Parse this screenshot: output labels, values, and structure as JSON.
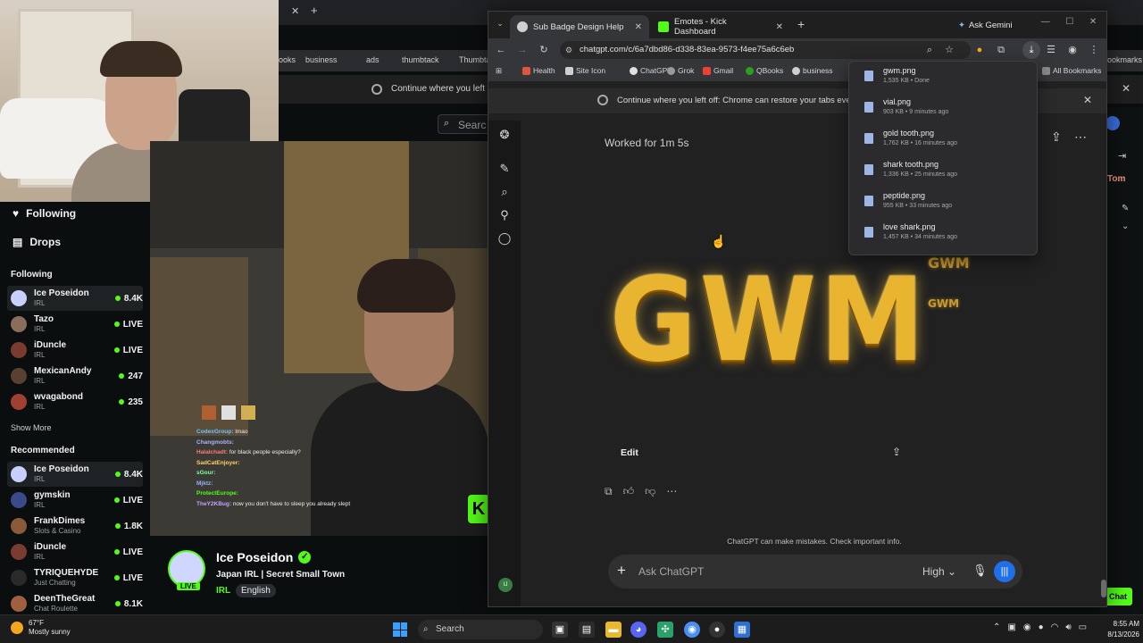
{
  "kick": {
    "browser_bookmarks": [
      "ooks",
      "business",
      "ads",
      "thumbtack",
      "Thumbta"
    ],
    "bookmarks_right": "ookmarks",
    "restore_text": "Continue where you left off:",
    "search_placeholder": "Searc",
    "nav": {
      "following": "Following",
      "drops": "Drops"
    },
    "following_label": "Following",
    "following": [
      {
        "name": "Ice Poseidon",
        "category": "IRL",
        "viewers": "8.4K",
        "color": "#c7d0ff"
      },
      {
        "name": "Tazo",
        "category": "IRL",
        "viewers": "LIVE",
        "color": "#8a6d5a"
      },
      {
        "name": "iDuncle",
        "category": "IRL",
        "viewers": "LIVE",
        "color": "#7a3b30"
      },
      {
        "name": "MexicanAndy",
        "category": "IRL",
        "viewers": "247",
        "color": "#5a4030"
      },
      {
        "name": "wvagabond",
        "category": "IRL",
        "viewers": "235",
        "color": "#a04030"
      }
    ],
    "show_more": "Show More",
    "recommended_label": "Recommended",
    "recommended": [
      {
        "name": "Ice Poseidon",
        "category": "IRL",
        "viewers": "8.4K",
        "color": "#c7d0ff"
      },
      {
        "name": "gymskin",
        "category": "IRL",
        "viewers": "LIVE",
        "color": "#3a4a8a"
      },
      {
        "name": "FrankDimes",
        "category": "Slots & Casino",
        "viewers": "1.8K",
        "color": "#8a5a3a"
      },
      {
        "name": "iDuncle",
        "category": "IRL",
        "viewers": "LIVE",
        "color": "#7a3b30"
      },
      {
        "name": "TYRIQUEHYDE",
        "category": "Just Chatting",
        "viewers": "LIVE",
        "color": "#2a2a2a"
      },
      {
        "name": "DeenTheGreat",
        "category": "Chat Roulette",
        "viewers": "8.1K",
        "color": "#a06040"
      }
    ],
    "chat": [
      {
        "user": "CodexGroup:",
        "msg": "lmao",
        "color": "#6ec3ff"
      },
      {
        "user": "Changmobts:",
        "msg": "",
        "color": "#b0b0ff"
      },
      {
        "user": "Halalchadt:",
        "msg": "for black people especially?",
        "color": "#ff7a7a"
      },
      {
        "user": "SadCatEnjoyer:",
        "msg": "",
        "color": "#ffd166"
      },
      {
        "user": "sGour:",
        "msg": "",
        "color": "#7fffa8"
      },
      {
        "user": "Mjktz:",
        "msg": "",
        "color": "#9ab0ff"
      },
      {
        "user": "ProtectEurope:",
        "msg": "",
        "color": "#53fc18"
      },
      {
        "user": "TheY2KBug:",
        "msg": "now you don't have to sleep you already slept",
        "color": "#c9a0ff"
      }
    ],
    "stream": {
      "live": "LIVE",
      "name": "Ice Poseidon",
      "title": "Japan IRL | Secret Small Town",
      "category": "IRL",
      "tag": "English"
    },
    "right_name": "Tom",
    "chat_button": "Chat"
  },
  "chrome": {
    "tabs": [
      {
        "label": "Sub Badge Design Help",
        "active": true
      },
      {
        "label": "Emotes - Kick Dashboard",
        "active": false
      }
    ],
    "ask_gemini": "Ask Gemini",
    "url": "chatgpt.com/c/6a7dbd86-d338-83ea-9573-f4ee75a6c6eb",
    "bookmarks": [
      "Health",
      "Site Icon",
      "ChatGPT",
      "Grok",
      "Gmail",
      "QBooks",
      "business"
    ],
    "all_bookmarks": "All Bookmarks",
    "restore_text": "Continue where you left off: Chrome can restore your tabs every tim",
    "downloads": [
      {
        "name": "gwm.png",
        "status": "1,535 KB • Done"
      },
      {
        "name": "vial.png",
        "status": "903 KB • 9 minutes ago"
      },
      {
        "name": "gold tooth.png",
        "status": "1,762 KB • 16 minutes ago"
      },
      {
        "name": "shark tooth.png",
        "status": "1,336 KB • 25 minutes ago"
      },
      {
        "name": "peptide.png",
        "status": "955 KB • 33 minutes ago"
      },
      {
        "name": "love shark.png",
        "status": "1,457 KB • 34 minutes ago"
      }
    ]
  },
  "chatgpt": {
    "worked_for": "Worked for 1m 5s",
    "image_text": "GWM",
    "edit_label": "Edit",
    "disclaimer": "ChatGPT can make mistakes. Check important info.",
    "composer_placeholder": "Ask ChatGPT",
    "model_label": "High",
    "user_initials": "IJ"
  },
  "taskbar": {
    "temperature": "67°F",
    "weather": "Mostly sunny",
    "search": "Search",
    "time": "8:55 AM",
    "date": "8/13/2026"
  }
}
